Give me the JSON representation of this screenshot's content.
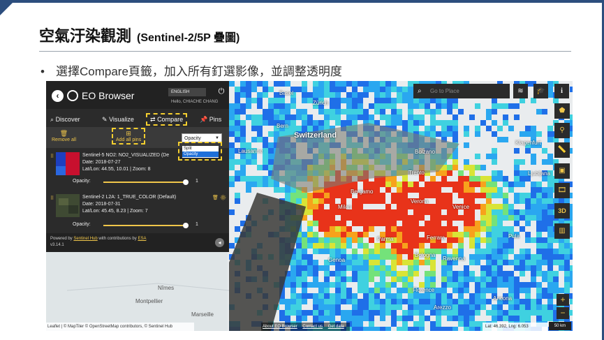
{
  "slide": {
    "title": "空氣汙染觀測",
    "subtitle": "(Sentinel-2/5P 疊圖)",
    "bullet": "選擇Compare頁籤，加入所有釘選影像，並調整透明度"
  },
  "app": {
    "title": "EO Browser",
    "language": "ENGLISH",
    "hello": "Hello, CHIACHE CHANG",
    "tabs": [
      "Discover",
      "Visualize",
      "Compare",
      "Pins"
    ],
    "actions": {
      "remove_all": "Remove all",
      "add_all_pins": "Add all pins"
    },
    "mode_select": {
      "value": "Opacity",
      "options": [
        "Split",
        "Opacity"
      ]
    },
    "pins": [
      {
        "title": "Sentinel-5 NO2: NO2_VISUALIZED (De",
        "date": "Date: 2018-07-27",
        "latlon": "Lat/Lon: 44.55, 10.01 | Zoom: 8",
        "opacity_label": "Opacity:",
        "opacity_value": "1"
      },
      {
        "title": "Sentinel-2 L2A: 1_TRUE_COLOR (Default)",
        "date": "Date: 2018-07-31",
        "latlon": "Lat/Lon: 45.45, 8.23 | Zoom: 7",
        "opacity_label": "Opacity:",
        "opacity_value": "1"
      }
    ],
    "footer": {
      "powered_by": "Powered by",
      "sentinel_hub": "Sentinel Hub",
      "with_contrib": "with contributions by",
      "esa": "ESA",
      "version": "v3.14.1"
    }
  },
  "map": {
    "search_placeholder": "Go to Place",
    "top_buttons": [
      "layers-icon",
      "education-icon",
      "info-icon"
    ],
    "side_buttons": [
      "pentagon-icon",
      "pin-icon",
      "ruler-icon",
      "image-icon",
      "film-icon",
      "3d-icon",
      "chart-icon"
    ],
    "side_labels": {
      "three_d": "3D"
    },
    "zoom_in": "+",
    "zoom_out": "−",
    "attribution": "Leaflet | © MapTiler © OpenStreetMap contributors, © Sentinel Hub",
    "links": [
      "About EO Browser",
      "Contact us",
      "Get data"
    ],
    "coords": "Lat: 46.392, Lng: 6.053",
    "scale": "50 km",
    "places": [
      {
        "name": "Switzerland",
        "style": "big"
      },
      {
        "name": "Basel"
      },
      {
        "name": "Zürich"
      },
      {
        "name": "Bern"
      },
      {
        "name": "Lausanne"
      },
      {
        "name": "Bolzano"
      },
      {
        "name": "Trento"
      },
      {
        "name": "Milan"
      },
      {
        "name": "Bergamo"
      },
      {
        "name": "Verona"
      },
      {
        "name": "Venice"
      },
      {
        "name": "Parma"
      },
      {
        "name": "Bologna"
      },
      {
        "name": "Ravenna"
      },
      {
        "name": "Ferrara"
      },
      {
        "name": "Genoa"
      },
      {
        "name": "Florence"
      },
      {
        "name": "Arezzo"
      },
      {
        "name": "Ancona"
      },
      {
        "name": "Pula"
      },
      {
        "name": "Klagenfurt"
      },
      {
        "name": "Ljubljana"
      },
      {
        "name": "Nîmes"
      },
      {
        "name": "Montpellier"
      },
      {
        "name": "Marseille"
      }
    ]
  },
  "colors": {
    "accent": "#f0c64a",
    "panel": "#2b2b2b",
    "slide_frame": "#2c4e7e"
  }
}
